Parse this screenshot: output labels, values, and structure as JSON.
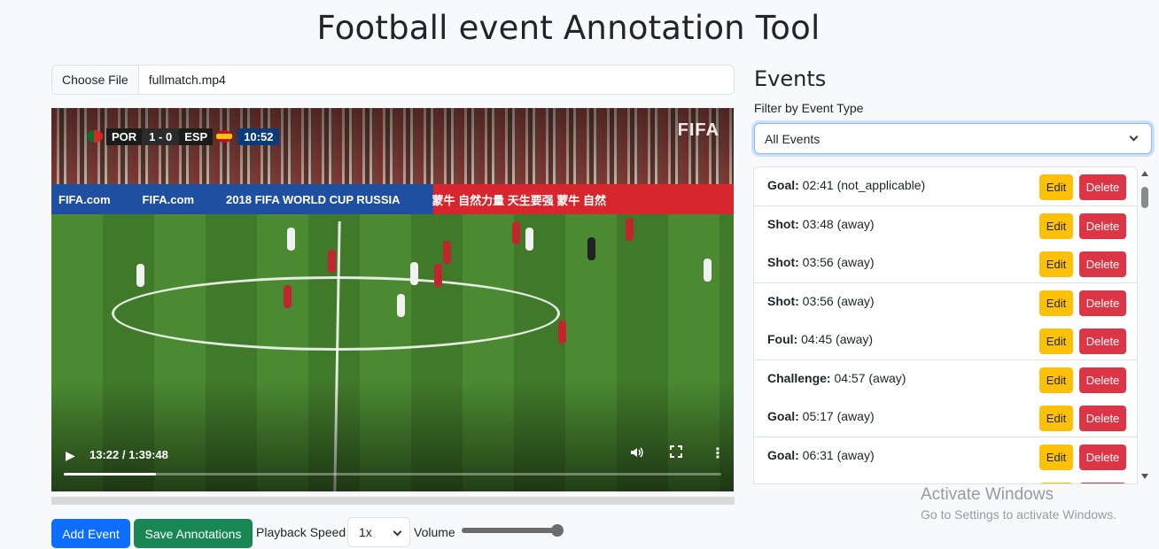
{
  "page": {
    "title": "Football event Annotation Tool"
  },
  "file": {
    "button_label": "Choose File",
    "file_name": "fullmatch.mp4"
  },
  "video": {
    "scorebug": {
      "home": "POR",
      "score": "1 - 0",
      "away": "ESP",
      "clock": "10:52"
    },
    "watermark": "FIFA",
    "ad_texts": [
      "FIFA.com",
      "FIFA.com",
      "2018 FIFA WORLD CUP RUSSIA",
      "蒙牛  自然力量 天生要强  蒙牛  自然"
    ],
    "current_time": "13:22 / 1:39:48",
    "progress": 0.14,
    "icons": {
      "play": "play-icon",
      "volume": "volume-icon",
      "fullscreen": "fullscreen-icon",
      "more": "more-options-icon"
    }
  },
  "controls": {
    "add_event_label": "Add Event",
    "save_label": "Save Annotations",
    "speed_label": "Playback Speed",
    "speed_value": "1x",
    "volume_label": "Volume",
    "volume_level": 1.0
  },
  "events": {
    "title": "Events",
    "filter_label": "Filter by Event Type",
    "filter_value": "All Events",
    "edit_label": "Edit",
    "delete_label": "Delete",
    "items": [
      {
        "type": "Goal:",
        "detail": "02:41 (not_applicable)"
      },
      {
        "type": "Shot:",
        "detail": "03:48 (away)"
      },
      {
        "type": "Shot:",
        "detail": "03:56 (away)"
      },
      {
        "type": "Shot:",
        "detail": "03:56 (away)"
      },
      {
        "type": "Foul:",
        "detail": "04:45 (away)"
      },
      {
        "type": "Challenge:",
        "detail": "04:57 (away)"
      },
      {
        "type": "Goal:",
        "detail": "05:17 (away)"
      },
      {
        "type": "Goal:",
        "detail": "06:31 (away)"
      },
      {
        "type": "",
        "detail": ""
      }
    ]
  },
  "os_notice": {
    "line1": "Activate Windows",
    "line2": "Go to Settings to activate Windows."
  },
  "colors": {
    "primary": "#0d6efd",
    "success": "#198754",
    "warning": "#ffc107",
    "danger": "#dc3545"
  }
}
